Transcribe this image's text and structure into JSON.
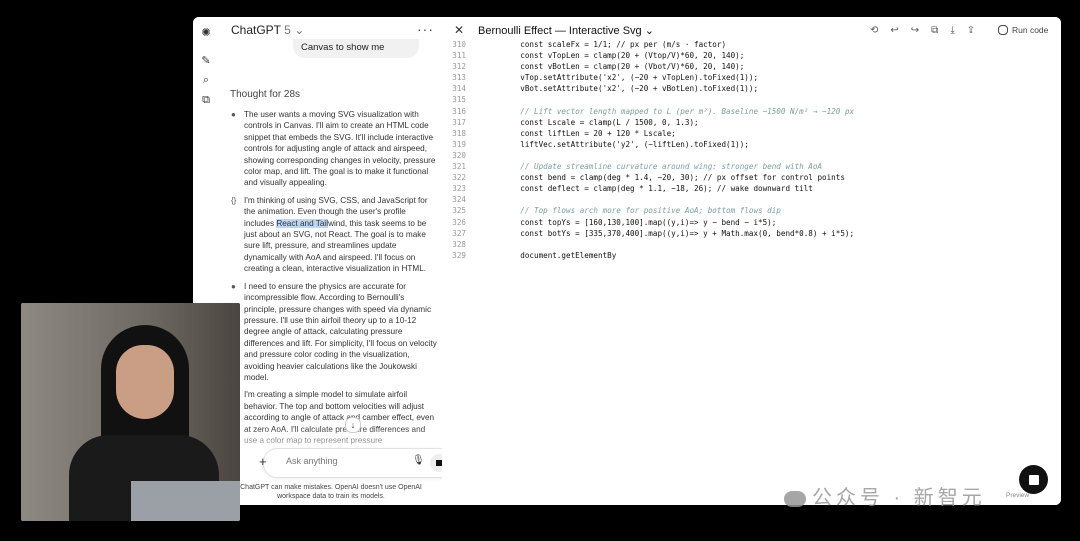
{
  "chat": {
    "model_name": "ChatGPT",
    "model_version": "5",
    "user_message": "Canvas to show me",
    "thought_label": "Thought for 28s",
    "steps": [
      {
        "marker": "●",
        "parts": [
          "The user wants a moving SVG visualization with controls in Canvas. I'll aim to create an HTML code snippet that embeds the SVG. It'll include interactive controls for adjusting angle of attack and airspeed, showing corresponding changes in velocity, pressure color map, and lift. The goal is to make it functional and visually appealing."
        ]
      },
      {
        "marker": "{}",
        "pre": "I'm thinking of using SVG, CSS, and JavaScript for the animation. Even though the user's profile includes ",
        "highlight": "React and Tail",
        "post": "wind, this task seems to be just about an SVG, not React. The goal is to make sure lift, pressure, and streamlines update dynamically with AoA and airspeed. I'll focus on creating a clean, interactive visualization in HTML."
      },
      {
        "marker": "●",
        "parts": [
          "I need to ensure the physics are accurate for incompressible flow. According to Bernoulli's principle, pressure changes with speed via dynamic pressure. I'll use thin airfoil theory up to a 10-12 degree angle of attack, calculating pressure differences and lift. For simplicity, I'll focus on velocity and pressure color coding in the visualization, avoiding heavier calculations like the Joukowski model."
        ]
      },
      {
        "marker": "",
        "parts": [
          "I'm creating a simple model to simulate airfoil behavior. The top and bottom velocities will adjust according to angle of attack and camber effect, even at zero AoA. I'll calculate pressure differences and use a color map to represent pressure"
        ]
      }
    ],
    "composer_placeholder": "Ask anything",
    "disclaimer": "ChatGPT can make mistakes. OpenAI doesn't use OpenAI workspace data to train its models."
  },
  "canvas": {
    "title": "Bernoulli Effect — Interactive Svg",
    "run_label": "Run code",
    "lines": [
      {
        "n": "310",
        "t": "    const scaleFx = 1/1; // px per (m/s · factor)"
      },
      {
        "n": "311",
        "t": "    const vTopLen = clamp(20 + (Vtop/V)*60, 20, 140);"
      },
      {
        "n": "312",
        "t": "    const vBotLen = clamp(20 + (Vbot/V)*60, 20, 140);"
      },
      {
        "n": "313",
        "t": "    vTop.setAttribute('x2', (−20 + vTopLen).toFixed(1));"
      },
      {
        "n": "314",
        "t": "    vBot.setAttribute('x2', (−20 + vBotLen).toFixed(1));"
      },
      {
        "n": "315",
        "t": ""
      },
      {
        "n": "316",
        "t": "    // Lift vector length mapped to L (per m²). Baseline ~1500 N/m² → ~120 px",
        "c": true
      },
      {
        "n": "317",
        "t": "    const Lscale = clamp(L / 1500, 0, 1.3);"
      },
      {
        "n": "318",
        "t": "    const liftLen = 20 + 120 * Lscale;"
      },
      {
        "n": "319",
        "t": "    liftVec.setAttribute('y2', (−liftLen).toFixed(1));"
      },
      {
        "n": "320",
        "t": ""
      },
      {
        "n": "321",
        "t": "    // Update streamline curvature around wing: stronger bend with AoA",
        "c": true
      },
      {
        "n": "322",
        "t": "    const bend = clamp(deg * 1.4, −20, 30); // px offset for control points"
      },
      {
        "n": "323",
        "t": "    const deflect = clamp(deg * 1.1, −18, 26); // wake downward tilt"
      },
      {
        "n": "324",
        "t": ""
      },
      {
        "n": "325",
        "t": "    // Top flows arch more for positive AoA; bottom flows dip",
        "c": true
      },
      {
        "n": "326",
        "t": "    const topYs = [160,130,100].map((y,i)=> y − bend − i*5);"
      },
      {
        "n": "327",
        "t": "    const botYs = [335,370,400].map((y,i)=> y + Math.max(0, bend*0.8) + i*5);"
      },
      {
        "n": "328",
        "t": ""
      },
      {
        "n": "329",
        "t": "    document.getElementBy"
      }
    ]
  },
  "watermark": {
    "text": "公众号 · 新智元",
    "small": "Preview"
  }
}
